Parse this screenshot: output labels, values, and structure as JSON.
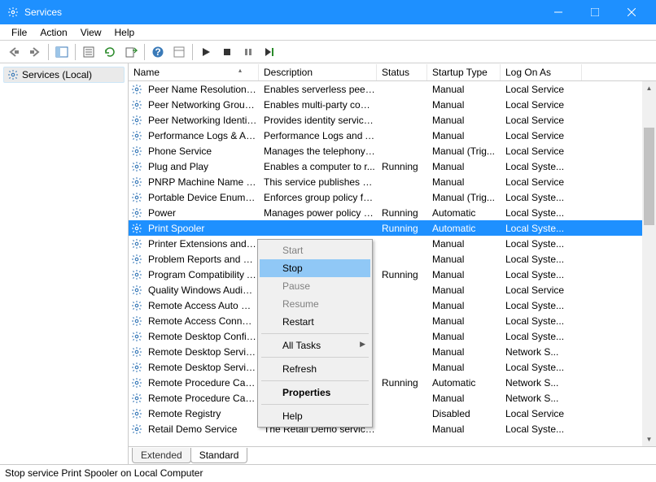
{
  "window": {
    "title": "Services"
  },
  "menubar": [
    "File",
    "Action",
    "View",
    "Help"
  ],
  "sidebar": {
    "node": "Services (Local)"
  },
  "columns": {
    "name": "Name",
    "description": "Description",
    "status": "Status",
    "startup": "Startup Type",
    "logon": "Log On As"
  },
  "services": [
    {
      "name": "Peer Name Resolution Prot...",
      "description": "Enables serverless peer n...",
      "status": "",
      "startup": "Manual",
      "logon": "Local Service"
    },
    {
      "name": "Peer Networking Grouping",
      "description": "Enables multi-party com...",
      "status": "",
      "startup": "Manual",
      "logon": "Local Service"
    },
    {
      "name": "Peer Networking Identity M...",
      "description": "Provides identity service...",
      "status": "",
      "startup": "Manual",
      "logon": "Local Service"
    },
    {
      "name": "Performance Logs & Alerts",
      "description": "Performance Logs and A...",
      "status": "",
      "startup": "Manual",
      "logon": "Local Service"
    },
    {
      "name": "Phone Service",
      "description": "Manages the telephony ...",
      "status": "",
      "startup": "Manual (Trig...",
      "logon": "Local Service"
    },
    {
      "name": "Plug and Play",
      "description": "Enables a computer to r...",
      "status": "Running",
      "startup": "Manual",
      "logon": "Local Syste..."
    },
    {
      "name": "PNRP Machine Name Publi...",
      "description": "This service publishes a ...",
      "status": "",
      "startup": "Manual",
      "logon": "Local Service"
    },
    {
      "name": "Portable Device Enumerator...",
      "description": "Enforces group policy fo...",
      "status": "",
      "startup": "Manual (Trig...",
      "logon": "Local Syste..."
    },
    {
      "name": "Power",
      "description": "Manages power policy a...",
      "status": "Running",
      "startup": "Automatic",
      "logon": "Local Syste..."
    },
    {
      "name": "Print Spooler",
      "description": "",
      "status": "Running",
      "startup": "Automatic",
      "logon": "Local Syste...",
      "selected": true
    },
    {
      "name": "Printer Extensions and Notif...",
      "description": "",
      "status": "",
      "startup": "Manual",
      "logon": "Local Syste..."
    },
    {
      "name": "Problem Reports and Soluti...",
      "description": "",
      "status": "",
      "startup": "Manual",
      "logon": "Local Syste..."
    },
    {
      "name": "Program Compatibility Assi...",
      "description": "",
      "status": "Running",
      "startup": "Manual",
      "logon": "Local Syste..."
    },
    {
      "name": "Quality Windows Audio Vid...",
      "description": "",
      "status": "",
      "startup": "Manual",
      "logon": "Local Service"
    },
    {
      "name": "Remote Access Auto Conne...",
      "description": "",
      "status": "",
      "startup": "Manual",
      "logon": "Local Syste..."
    },
    {
      "name": "Remote Access Connection...",
      "description": "",
      "status": "",
      "startup": "Manual",
      "logon": "Local Syste..."
    },
    {
      "name": "Remote Desktop Configurat...",
      "description": "",
      "status": "",
      "startup": "Manual",
      "logon": "Local Syste..."
    },
    {
      "name": "Remote Desktop Services",
      "description": "",
      "status": "",
      "startup": "Manual",
      "logon": "Network S..."
    },
    {
      "name": "Remote Desktop Services U...",
      "description": "",
      "status": "",
      "startup": "Manual",
      "logon": "Local Syste..."
    },
    {
      "name": "Remote Procedure Call (RPC)",
      "description": "",
      "status": "Running",
      "startup": "Automatic",
      "logon": "Network S..."
    },
    {
      "name": "Remote Procedure Call (RP...",
      "description": "",
      "status": "",
      "startup": "Manual",
      "logon": "Network S..."
    },
    {
      "name": "Remote Registry",
      "description": "",
      "status": "",
      "startup": "Disabled",
      "logon": "Local Service"
    },
    {
      "name": "Retail Demo Service",
      "description": "The Retail Demo service ...",
      "status": "",
      "startup": "Manual",
      "logon": "Local Syste..."
    }
  ],
  "context_menu": {
    "items": [
      {
        "label": "Start",
        "disabled": true
      },
      {
        "label": "Stop",
        "hover": true
      },
      {
        "label": "Pause",
        "disabled": true
      },
      {
        "label": "Resume",
        "disabled": true
      },
      {
        "label": "Restart"
      },
      {
        "sep": true
      },
      {
        "label": "All Tasks",
        "submenu": true
      },
      {
        "sep": true
      },
      {
        "label": "Refresh"
      },
      {
        "sep": true
      },
      {
        "label": "Properties",
        "bold": true
      },
      {
        "sep": true
      },
      {
        "label": "Help"
      }
    ]
  },
  "tabs": {
    "extended": "Extended",
    "standard": "Standard"
  },
  "statusbar": "Stop service Print Spooler on Local Computer"
}
